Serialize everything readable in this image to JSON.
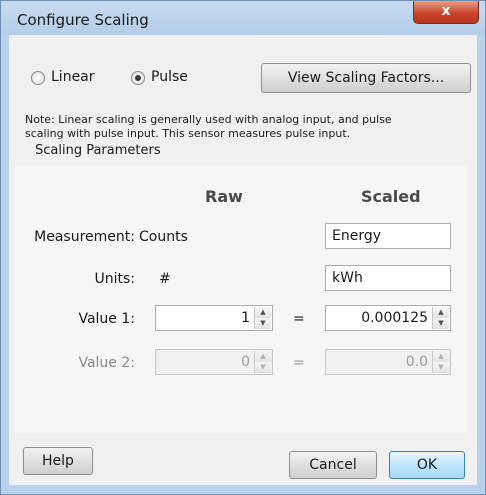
{
  "window": {
    "title": "Configure Scaling",
    "close_label": "x"
  },
  "mode": {
    "linear_label": "Linear",
    "pulse_label": "Pulse",
    "selected": "Pulse"
  },
  "view_factors_label": "View Scaling Factors...",
  "note_text": "Note: Linear scaling is generally used with analog input, and pulse scaling with pulse input. This sensor measures pulse input.",
  "scaling": {
    "section_title": "Scaling Parameters",
    "raw_header": "Raw",
    "scaled_header": "Scaled",
    "rows": {
      "measurement": {
        "label": "Measurement:",
        "raw": "Counts",
        "scaled": "Energy"
      },
      "units": {
        "label": "Units:",
        "raw": "#",
        "scaled": "kWh"
      },
      "value1": {
        "label": "Value 1:",
        "raw": "1",
        "eq": "=",
        "scaled": "0.000125"
      },
      "value2": {
        "label": "Value 2:",
        "raw": "0",
        "eq": "=",
        "scaled": "0.0"
      }
    }
  },
  "buttons": {
    "help": "Help",
    "cancel": "Cancel",
    "ok": "OK"
  },
  "icons": {
    "close": "close-icon",
    "spin_up": "spin-up-icon",
    "spin_down": "spin-down-icon"
  },
  "colors": {
    "ok_accent": "#a7d9f5",
    "close_red": "#c9452b"
  }
}
